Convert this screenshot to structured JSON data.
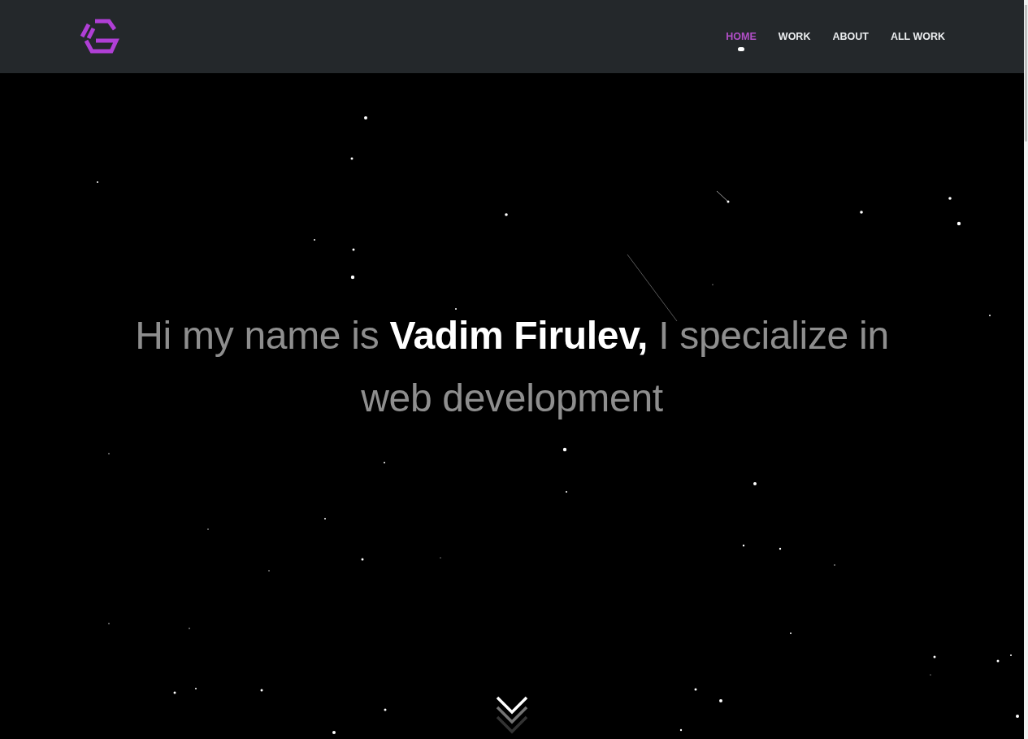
{
  "navbar": {
    "links": [
      {
        "label": "HOME",
        "selected": true
      },
      {
        "label": "WORK",
        "selected": false
      },
      {
        "label": "ABOUT",
        "selected": false
      },
      {
        "label": "ALL WORK",
        "selected": false
      }
    ]
  },
  "hero": {
    "headline": "Hi my name is **Vadim Firulev,** I specialize in web development"
  }
}
